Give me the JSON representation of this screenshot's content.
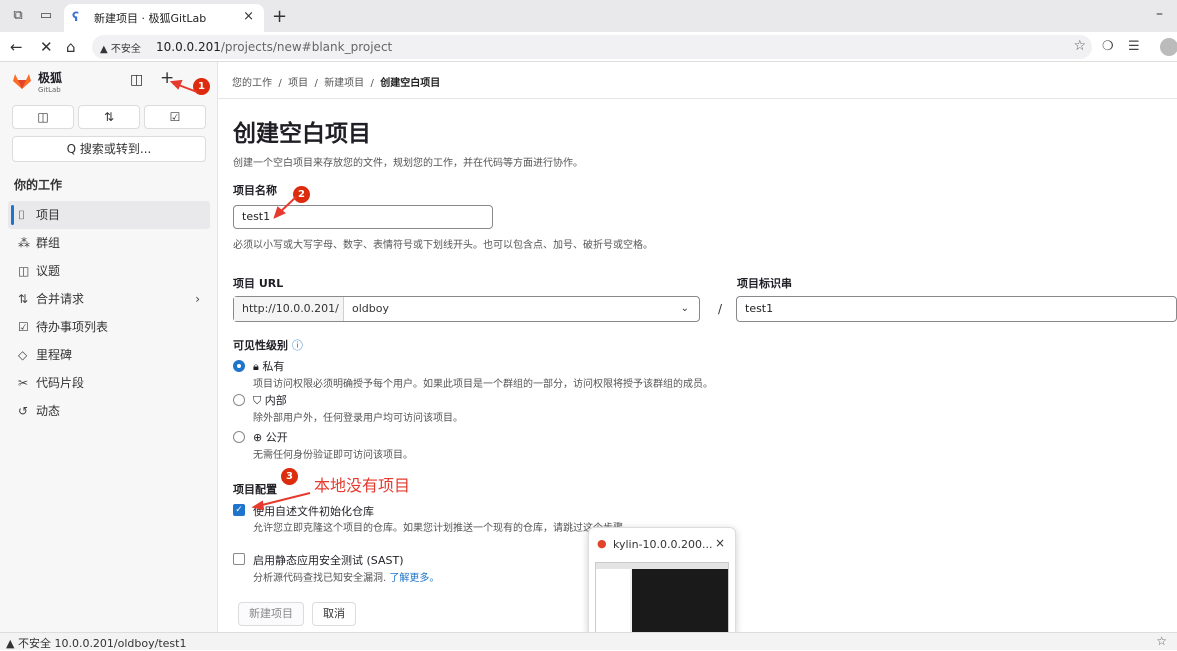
{
  "browser": {
    "tab_title": "新建项目 · 极狐GitLab",
    "tab_close": "×",
    "new_tab": "+",
    "minimize": "–",
    "security_warning": "▲ 不安全",
    "url_host": "10.0.0.201",
    "url_path": "/projects/new#blank_project"
  },
  "sidebar": {
    "brand_name": "极狐",
    "brand_sub": "GitLab",
    "search_label": "Q 搜索或转到...",
    "section_title": "你的工作",
    "items": [
      {
        "label": "项目",
        "icon": "project-icon",
        "glyph": "⌷"
      },
      {
        "label": "群组",
        "icon": "group-icon",
        "glyph": "⁂"
      },
      {
        "label": "议题",
        "icon": "issues-icon",
        "glyph": "◫"
      },
      {
        "label": "合并请求",
        "icon": "merge-request-icon",
        "glyph": "⇅"
      },
      {
        "label": "待办事项列表",
        "icon": "todo-icon",
        "glyph": "☑"
      },
      {
        "label": "里程碑",
        "icon": "milestone-icon",
        "glyph": "◇"
      },
      {
        "label": "代码片段",
        "icon": "snippet-icon",
        "glyph": "✂"
      },
      {
        "label": "动态",
        "icon": "activity-icon",
        "glyph": "↺"
      }
    ]
  },
  "breadcrumb": {
    "items": [
      "您的工作",
      "项目",
      "新建项目"
    ],
    "current": "创建空白项目"
  },
  "page": {
    "title": "创建空白项目",
    "description": "创建一个空白项目来存放您的文件，规划您的工作，并在代码等方面进行协作。"
  },
  "form": {
    "name_label": "项目名称",
    "name_value": "test1",
    "name_help": "必须以小写或大写字母、数字、表情符号或下划线开头。也可以包含点、加号、破折号或空格。",
    "url_label": "项目 URL",
    "url_prefix": "http://10.0.0.201/",
    "namespace": "oldboy",
    "slash": "/",
    "slug_label": "项目标识串",
    "slug_value": "test1",
    "visibility_label": "可见性级别",
    "visibility_options": [
      {
        "title": "私有",
        "desc": "项目访问权限必须明确授予每个用户。如果此项目是一个群组的一部分，访问权限将授予该群组的成员。",
        "checked": true,
        "glyph": "🔒︎"
      },
      {
        "title": "内部",
        "desc": "除外部用户外，任何登录用户均可访问该项目。",
        "checked": false,
        "glyph": "⛉"
      },
      {
        "title": "公开",
        "desc": "无需任何身份验证即可访问该项目。",
        "checked": false,
        "glyph": "⊕"
      }
    ],
    "config_label": "项目配置",
    "readme_title": "使用自述文件初始化仓库",
    "readme_desc": "允许您立即克隆这个项目的仓库。如果您计划推送一个现有的仓库，请跳过这个步骤。",
    "readme_checked": true,
    "sast_title": "启用静态应用安全测试 (SAST)",
    "sast_desc": "分析源代码查找已知安全漏洞.",
    "sast_link": "了解更多。",
    "sast_checked": false,
    "create_button": "新建项目",
    "cancel_button": "取消"
  },
  "annotations": {
    "badge1": "1",
    "badge2": "2",
    "badge3": "3",
    "note": "本地没有项目"
  },
  "preview": {
    "title": "kylin-10.0.0.200...",
    "close": "×"
  },
  "statusbar": {
    "text": "▲ 不安全   10.0.0.201/oldboy/test1"
  },
  "colors": {
    "accent": "#1f75cb",
    "annotation_red": "#e63a2e",
    "badge_red": "#dd2b0e"
  }
}
